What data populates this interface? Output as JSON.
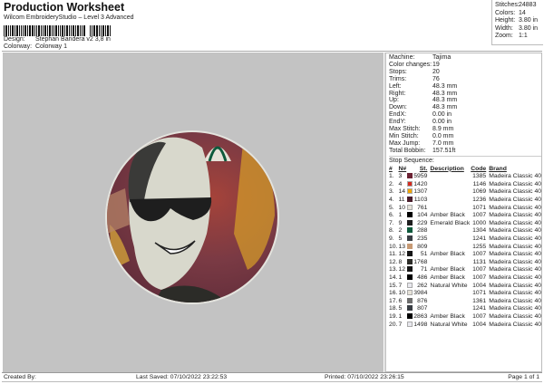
{
  "header": {
    "title": "Production Worksheet",
    "subtitle": "Wilcom EmbroideryStudio – Level 3 Advanced",
    "design_label": "Design:",
    "design_value": "Stephan Bandera v2 3,8 in",
    "colorway_label": "Colorway:",
    "colorway_value": "Colorway 1"
  },
  "summary": [
    {
      "label": "Stitches:",
      "value": "24883"
    },
    {
      "label": "Colors:",
      "value": "14"
    },
    {
      "label": "Height:",
      "value": "3.80 in"
    },
    {
      "label": "Width:",
      "value": "3.80 in"
    },
    {
      "label": "Zoom:",
      "value": "1:1"
    }
  ],
  "stats": [
    {
      "label": "Machine:",
      "value": "Tajima"
    },
    {
      "label": "Color changes:",
      "value": "19"
    },
    {
      "label": "Stops:",
      "value": "20"
    },
    {
      "label": "Trims:",
      "value": "76"
    },
    {
      "label": "Left:",
      "value": "48.3 mm"
    },
    {
      "label": "Right:",
      "value": "48.3 mm"
    },
    {
      "label": "Up:",
      "value": "48.3 mm"
    },
    {
      "label": "Down:",
      "value": "48.3 mm"
    },
    {
      "label": "EndX:",
      "value": "0.00 in"
    },
    {
      "label": "EndY:",
      "value": "0.00 in"
    },
    {
      "label": "Max Stitch:",
      "value": "8.9 mm"
    },
    {
      "label": "Min Stitch:",
      "value": "0.0 mm"
    },
    {
      "label": "Max Jump:",
      "value": "7.0 mm"
    },
    {
      "label": "Total Bobbin:",
      "value": "157.51ft"
    }
  ],
  "stop_sequence": {
    "title": "Stop Sequence:",
    "headers": [
      "#",
      "N#",
      "St.",
      "Description",
      "Code",
      "Brand"
    ],
    "rows": [
      [
        "1.",
        "3",
        "#6b2233",
        "5959",
        "",
        "1385",
        "Madeira Classic 40"
      ],
      [
        "2.",
        "4",
        "#d42a1e",
        "1420",
        "",
        "1146",
        "Madeira Classic 40"
      ],
      [
        "3.",
        "14",
        "#f0a400",
        "1307",
        "",
        "1069",
        "Madeira Classic 40"
      ],
      [
        "4.",
        "11",
        "#4a1e2c",
        "1103",
        "",
        "1236",
        "Madeira Classic 40"
      ],
      [
        "5.",
        "10",
        "#e6e2d8",
        "761",
        "",
        "1071",
        "Madeira Classic 40"
      ],
      [
        "6.",
        "1",
        "#000000",
        "104",
        "Amber Black",
        "1007",
        "Madeira Classic 40"
      ],
      [
        "7.",
        "9",
        "#1e1e1e",
        "229",
        "Emerald Black",
        "1000",
        "Madeira Classic 40"
      ],
      [
        "8.",
        "2",
        "#0e5a3c",
        "288",
        "",
        "1304",
        "Madeira Classic 40"
      ],
      [
        "9.",
        "5",
        "#3a3e44",
        "235",
        "",
        "1241",
        "Madeira Classic 40"
      ],
      [
        "10.",
        "13",
        "#c79a74",
        "809",
        "",
        "1255",
        "Madeira Classic 40"
      ],
      [
        "11.",
        "12",
        "#161616",
        "51",
        "Amber Black",
        "1007",
        "Madeira Classic 40"
      ],
      [
        "12.",
        "8",
        "#2c2c28",
        "1768",
        "",
        "1131",
        "Madeira Classic 40"
      ],
      [
        "13.",
        "12",
        "#161616",
        "71",
        "Amber Black",
        "1007",
        "Madeira Classic 40"
      ],
      [
        "14.",
        "1",
        "#000000",
        "486",
        "Amber Black",
        "1007",
        "Madeira Classic 40"
      ],
      [
        "15.",
        "7",
        "#e8e8ee",
        "262",
        "Natural White",
        "1004",
        "Madeira Classic 40"
      ],
      [
        "16.",
        "10",
        "#e6e2d8",
        "3984",
        "",
        "1071",
        "Madeira Classic 40"
      ],
      [
        "17.",
        "6",
        "#6e6e6e",
        "876",
        "",
        "1361",
        "Madeira Classic 40"
      ],
      [
        "18.",
        "5",
        "#3a3e44",
        "807",
        "",
        "1241",
        "Madeira Classic 40"
      ],
      [
        "19.",
        "1",
        "#000000",
        "2863",
        "Amber Black",
        "1007",
        "Madeira Classic 40"
      ],
      [
        "20.",
        "7",
        "#e8e8ee",
        "1498",
        "Natural White",
        "1004",
        "Madeira Classic 40"
      ]
    ]
  },
  "footer": {
    "created_by": "Created By:",
    "last_saved": "Last Saved: 07/10/2022 23:22:53",
    "printed": "Printed: 07/10/2022 23:26:15",
    "page": "Page 1 of 1"
  }
}
